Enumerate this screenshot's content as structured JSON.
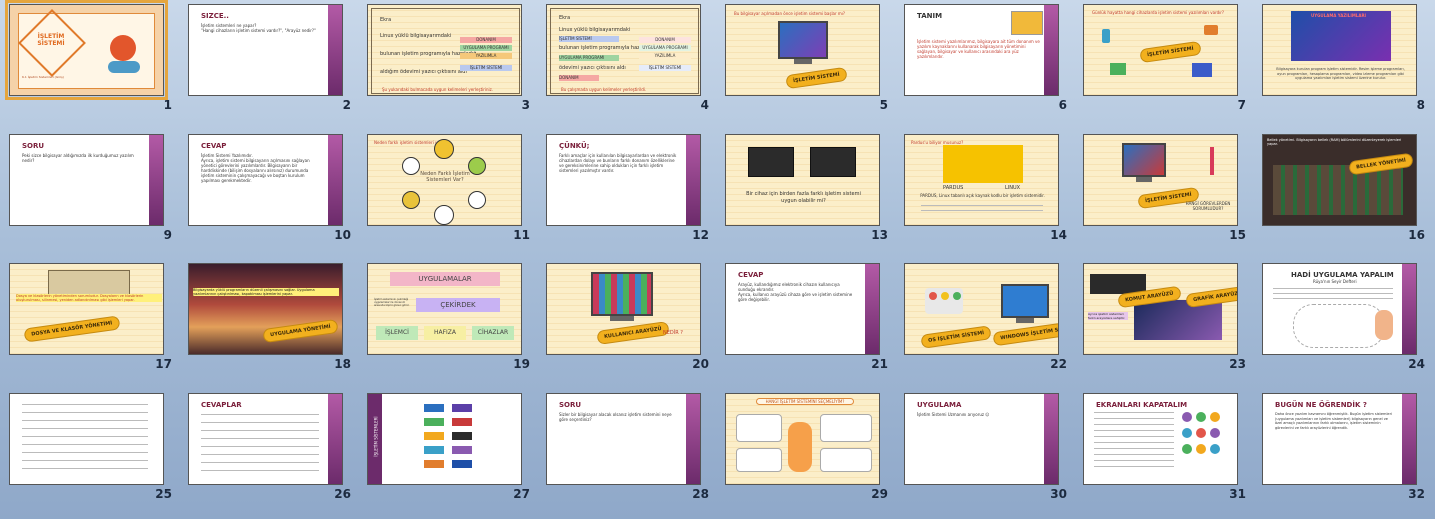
{
  "slides": [
    {
      "num": "1",
      "title": "İŞLETİM SİSTEMİ",
      "subtitle": "6.1 İşletim Sistemleri (Giriş)"
    },
    {
      "num": "2",
      "title": "SIZCE..",
      "bullets": [
        "İşletim sistemleri ne yapar?",
        "\"Hangi cihazların işletim sistemi vardır?\", \"Arayüz nedir?\""
      ]
    },
    {
      "num": "3",
      "rows": [
        "Ekra",
        "Linux yüklü bilgisayarımdaki",
        "bulunan işletim programıyla hazırladığ",
        "aldığım ödevimi yazıcı çıktısını aldı"
      ],
      "chips": [
        "DONANIM",
        "UYGULAMA PROGRAMI",
        "YAZILIMLA",
        "İŞLETİM SİSTEMİ"
      ],
      "footer": "Şu yukarıdaki bulmacada uygun kelimeleri yerleştiriniz."
    },
    {
      "num": "4",
      "rows": [
        "Ekra",
        "Linux yüklü bilgisayarımdaki",
        "İŞLETİM SİSTEMİ",
        "bulunan işletim programıyla hazırladığ",
        "UYGULAMA PROGRAMI",
        "ödevimi yazıcı çıktısını aldı",
        "DONANIM"
      ],
      "chips": [
        "DONANIM",
        "UYGULAMA PROGRAMI",
        "YAZILIMLA",
        "İŞLETİM SİSTEMİ"
      ],
      "footer": "Bu çalışmada uygun kelimeler yerleştirildi."
    },
    {
      "num": "5",
      "caption": "Bu bilgisayar açılmadan önce işletim sistemi başlar mı?",
      "badge": "İŞLETİM SİSTEMİ"
    },
    {
      "num": "6",
      "title": "TANIM",
      "body": "İşletim sistemi yazılımlarımız, bilgisayara ait tüm donanım ve yazılım kaynaklarını kullanarak bilgisayarın yönetimini sağlayan, bilgisayar ve kullanıcı arasındaki ara yüz yazılımlarıdır."
    },
    {
      "num": "7",
      "caption": "Günlük hayatta hangi cihazlarda işletim sistemi yazılımları vardır?",
      "badge": "İŞLETİM SİSTEMİ"
    },
    {
      "num": "8",
      "banner": "UYGULAMA YAZILIMLARI",
      "body": "Bilgisayara kurulan program işletim sistemidir. Resim işleme programları, oyun programları, hesaplama programları, video izleme programları gibi uygulama yazılımları işletim sistemi üzerine kurulur."
    },
    {
      "num": "9",
      "title": "SORU",
      "bullets": [
        "Peki sizce bilgisayar aldığımızda ilk kurduğumuz yazılım nedir?"
      ]
    },
    {
      "num": "10",
      "title": "CEVAP",
      "bullets": [
        "İşletim Sistemi Yazılımıdır.",
        "Ayrıca, işletim sistemi bilgisayarın açılmasını sağlayan yönetici görevlerini yazılımlardır. Bilgisayarın bir harddiskinde (bilişim dosyalarını alırsınız) durumunda işletim sisteminin çalışmayacağı ve boştan kurulum yapılması gerekmektedir."
      ]
    },
    {
      "num": "11",
      "caption": "Neden farklı işletim sistemleri var?",
      "center": "Neden Farklı İşletim Sistemleri Var?"
    },
    {
      "num": "12",
      "title": "ÇÜNKÜ;",
      "bullets": [
        "Farklı amaçlar için kullanılan bilgisayarlardan ve elektronik cihazlardan dolayı ve bunların farklı donanım özelliklerine ve gereksinimlerine sahip oldukları için farklı işletim sistemleri yazılmıştır vardır."
      ]
    },
    {
      "num": "13",
      "caption": "Bir cihaz için birden fazla farklı işletim sistemi uygun olabilir mi?"
    },
    {
      "num": "14",
      "caption": "Pardus'u biliyor musunuz?",
      "logoLeft": "PARDUS",
      "logoRight": "LINUX",
      "body": "PARDUS, Linux tabanlı açık kaynak kodlu bir işletim sistemidir."
    },
    {
      "num": "15",
      "badge": "İŞLETİM SİSTEMİ",
      "caption": "HANGİ GÖREVLERDEN SORUMLUDUR?"
    },
    {
      "num": "16",
      "caption": "Bellek yönetimi. Bilgisayarın bellek (RAM) bölümlerini düzenleyerek işlemleri yapar.",
      "badge": "BELLEK YÖNETİMİ"
    },
    {
      "num": "17",
      "caption": "Dosya ve klasörlerin yönetiminden sorumludur. Dosyaların ve klasörlerin oluşturulması, silinmesi, yeniden adlandırılması gibi işlemleri yapar.",
      "badge": "DOSYA VE KLASÖR YÖNETİMİ"
    },
    {
      "num": "18",
      "caption": "Bilgisayarda yüklü programların düzenli çalışmasını sağlar. Uygulama yazılımlarının çalıştırılması, kapatılması işlemlerini yapar.",
      "badge": "UYGULAMA YÖNETİMİ"
    },
    {
      "num": "19",
      "top": "UYGULAMALAR",
      "middle": "ÇEKİRDEK",
      "bottom": [
        "İŞLEMCİ",
        "HAFIZA",
        "CİHAZLAR"
      ],
      "side": "İşletim sisteminin çekirdeği uygulamalar ile donanım arasında köprü görevi görür."
    },
    {
      "num": "20",
      "badge": "KULLANICI ARAYÜZÜ",
      "caption": "NEDİR ?"
    },
    {
      "num": "21",
      "title": "CEVAP",
      "bullets": [
        "Arayüz, kullandığımız elektronik cihazın kullanıcıya sunduğu ekrandır.",
        "Ayrıca, kullanıcı arayüzü cihaza göre ve işletim sistemine göre değişebilir."
      ]
    },
    {
      "num": "22",
      "badgeLeft": "OS İŞLETİM SİSTEMİ",
      "badgeRight": "WINDOWS İŞLETİM SİSTEMİ"
    },
    {
      "num": "23",
      "badgeLeft": "KOMUT ARAYÜZÜ",
      "badgeRight": "GRAFİK ARAYÜZ",
      "caption": "Ayrıca işletim sistemleri farklı arayüzlere sahiptir."
    },
    {
      "num": "24",
      "title": "HADİ UYGULAMA YAPALIM",
      "subtitle": "Rüya'nın Seyir Defteri"
    },
    {
      "num": "25"
    },
    {
      "num": "26",
      "title": "CEVAPLAR"
    },
    {
      "num": "27",
      "sideTitle": "İŞLETİM SİSTEMLERİ"
    },
    {
      "num": "28",
      "title": "SORU",
      "bullets": [
        "Sizler bir bilgisayar alacak olsanız işletim sistemini neye göre seçerdiniz?"
      ]
    },
    {
      "num": "29",
      "title": "HANGİ İŞLETİM SİSTEMİNİ SEÇMELİYİM?"
    },
    {
      "num": "30",
      "title": "UYGULAMA",
      "bullets": [
        "İşletim Sistemi Uzmanını arıyoruz ☺"
      ]
    },
    {
      "num": "31",
      "title": "EKRANLARI KAPATALIM"
    },
    {
      "num": "32",
      "title": "BUGÜN NE ÖĞRENDİK ?",
      "bullets": [
        "Daha önce yazılım kavramını öğrenmiştik. Bugün işletim sistemleri (uygulama yazılımları ve işletim sistemleri) bilgisayarın genel ve özel amaçlı yazılımlarının farklı olmalarını, işletim sisteminin görevlerini ve farklı arayüzlerini öğrendik."
      ]
    }
  ]
}
